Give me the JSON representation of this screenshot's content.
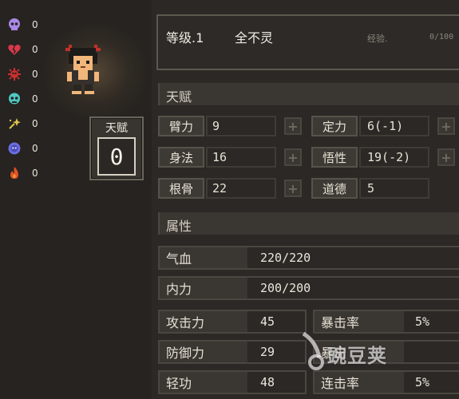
{
  "resources": [
    {
      "icon": "skull-icon",
      "color": "#a889e6",
      "count": "0"
    },
    {
      "icon": "broken-heart-icon",
      "color": "#d8394a",
      "count": "0"
    },
    {
      "icon": "red-virus-icon",
      "color": "#cc2f2f",
      "count": "0"
    },
    {
      "icon": "teal-skull-icon",
      "color": "#4fc7c2",
      "count": "0"
    },
    {
      "icon": "yellow-spark-icon",
      "color": "#e0c44e",
      "count": "0"
    },
    {
      "icon": "purple-face-icon",
      "color": "#6b6ee0",
      "count": "0"
    },
    {
      "icon": "fire-icon",
      "color": "#e35428",
      "count": "0"
    }
  ],
  "talent_card": {
    "title": "天赋",
    "value": "0"
  },
  "header": {
    "level": "等级.1",
    "name": "全不灵",
    "exp_label": "经验.",
    "exp_value": "0/100"
  },
  "talents": {
    "section_title": "天赋",
    "stats": [
      {
        "label": "臂力",
        "value": "9"
      },
      {
        "label": "定力",
        "value": "6(-1)"
      },
      {
        "label": "身法",
        "value": "16"
      },
      {
        "label": "悟性",
        "value": "19(-2)"
      },
      {
        "label": "根骨",
        "value": "22"
      },
      {
        "label": "道德",
        "value": "5"
      }
    ]
  },
  "attributes": {
    "section_title": "属性",
    "hp": {
      "label": "气血",
      "value": "220/220"
    },
    "mp": {
      "label": "内力",
      "value": "200/200"
    },
    "rows": [
      {
        "label": "攻击力",
        "value": "45",
        "label2": "暴击率",
        "value2": "5%"
      },
      {
        "label": "防御力",
        "value": "29",
        "label2": "暴击",
        "value2": ""
      },
      {
        "label": "轻功",
        "value": "48",
        "label2": "连击率",
        "value2": "5%"
      }
    ]
  },
  "watermark": {
    "text": "豌豆荚"
  },
  "colors": {
    "background": "#262320",
    "panel": "#2b2825",
    "border": "#5d5850"
  }
}
